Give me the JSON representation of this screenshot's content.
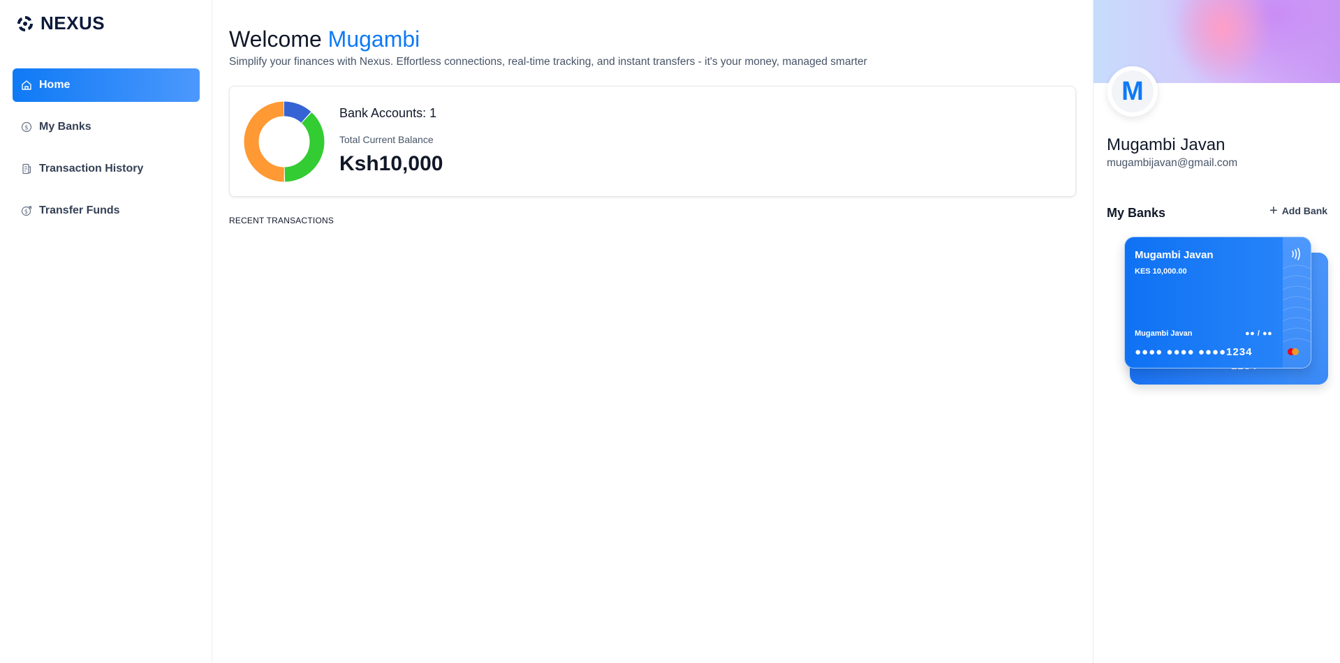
{
  "brand": {
    "name": "NEXUS",
    "logo_icon": "nexus-logo-icon"
  },
  "sidebar": {
    "items": [
      {
        "label": "Home",
        "icon": "home-icon",
        "active": true
      },
      {
        "label": "My Banks",
        "icon": "dollar-circle-icon",
        "active": false
      },
      {
        "label": "Transaction History",
        "icon": "receipt-icon",
        "active": false
      },
      {
        "label": "Transfer Funds",
        "icon": "money-send-icon",
        "active": false
      }
    ]
  },
  "header": {
    "greeting": "Welcome",
    "user_first_name": "Mugambi",
    "subtitle": "Simplify your finances with Nexus. Effortless connections, real-time tracking, and instant transfers - it's your money, managed smarter"
  },
  "balance": {
    "bank_accounts_label": "Bank Accounts: 1",
    "total_label": "Total Current Balance",
    "total_value": "Ksh10,000",
    "donut_segments": [
      {
        "fraction": 0.12,
        "color": "#3563d4"
      },
      {
        "fraction": 0.38,
        "color": "#33cc33"
      },
      {
        "fraction": 0.5,
        "color": "#ff9933"
      }
    ]
  },
  "recent": {
    "label": "RECENT TRANSACTIONS"
  },
  "profile": {
    "initial": "M",
    "name": "Mugambi Javan",
    "email": "mugambijavan@gmail.com"
  },
  "banks": {
    "title": "My Banks",
    "add_label": "Add Bank",
    "card": {
      "holder": "Mugambi Javan",
      "amount": "KES 10,000.00",
      "expiry": "●● / ●●",
      "number": "●●●● ●●●● ●●●●1234"
    }
  },
  "colors": {
    "accent": "#0f7af5",
    "text": "#101828",
    "muted": "#475467"
  }
}
